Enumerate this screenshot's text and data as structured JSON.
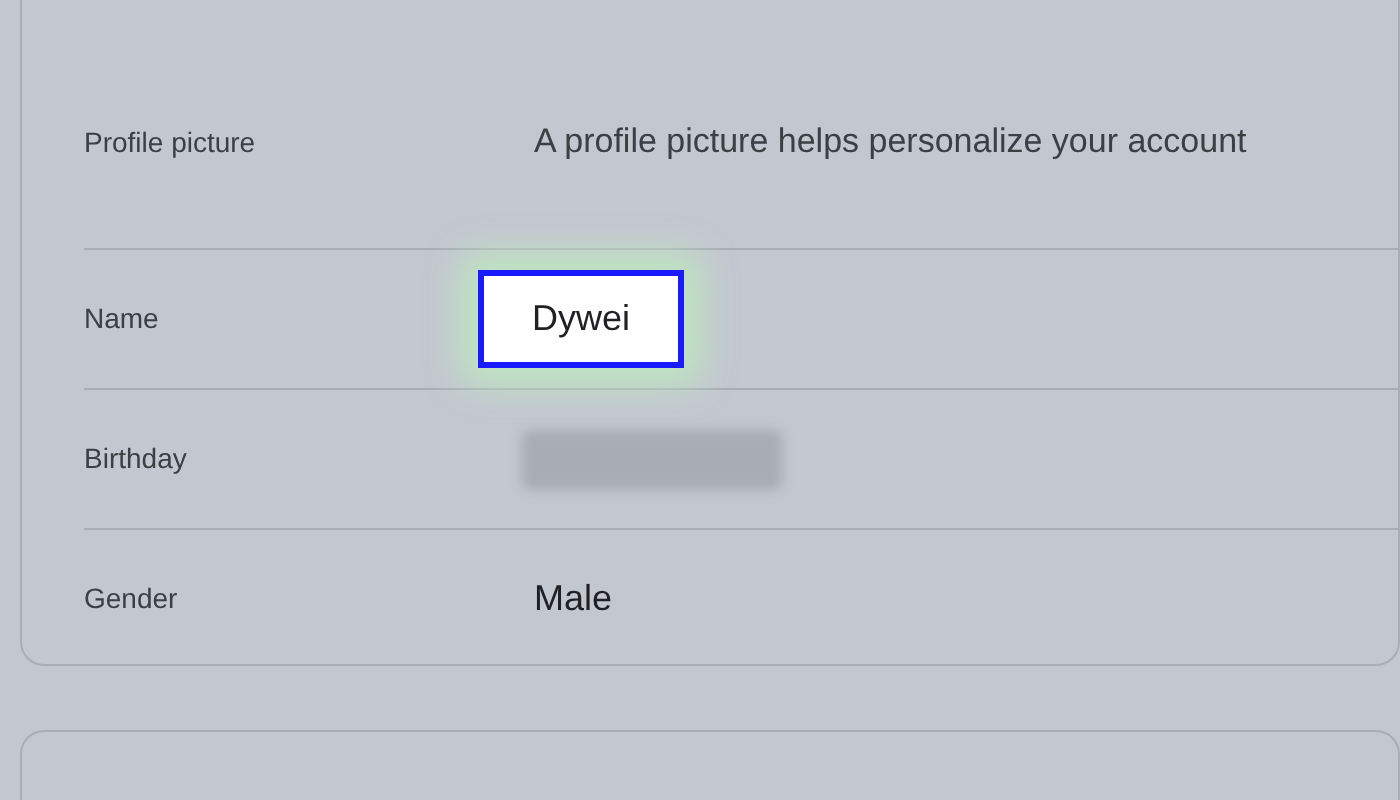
{
  "rows": [
    {
      "label": "Profile picture",
      "kind": "text",
      "value": "A profile picture helps personalize your account",
      "highlighted": false
    },
    {
      "label": "Name",
      "kind": "text",
      "value": "Dywei",
      "highlighted": true
    },
    {
      "label": "Birthday",
      "kind": "blurred",
      "highlighted": false
    },
    {
      "label": "Gender",
      "kind": "text",
      "value": "Male",
      "highlighted": false
    }
  ]
}
